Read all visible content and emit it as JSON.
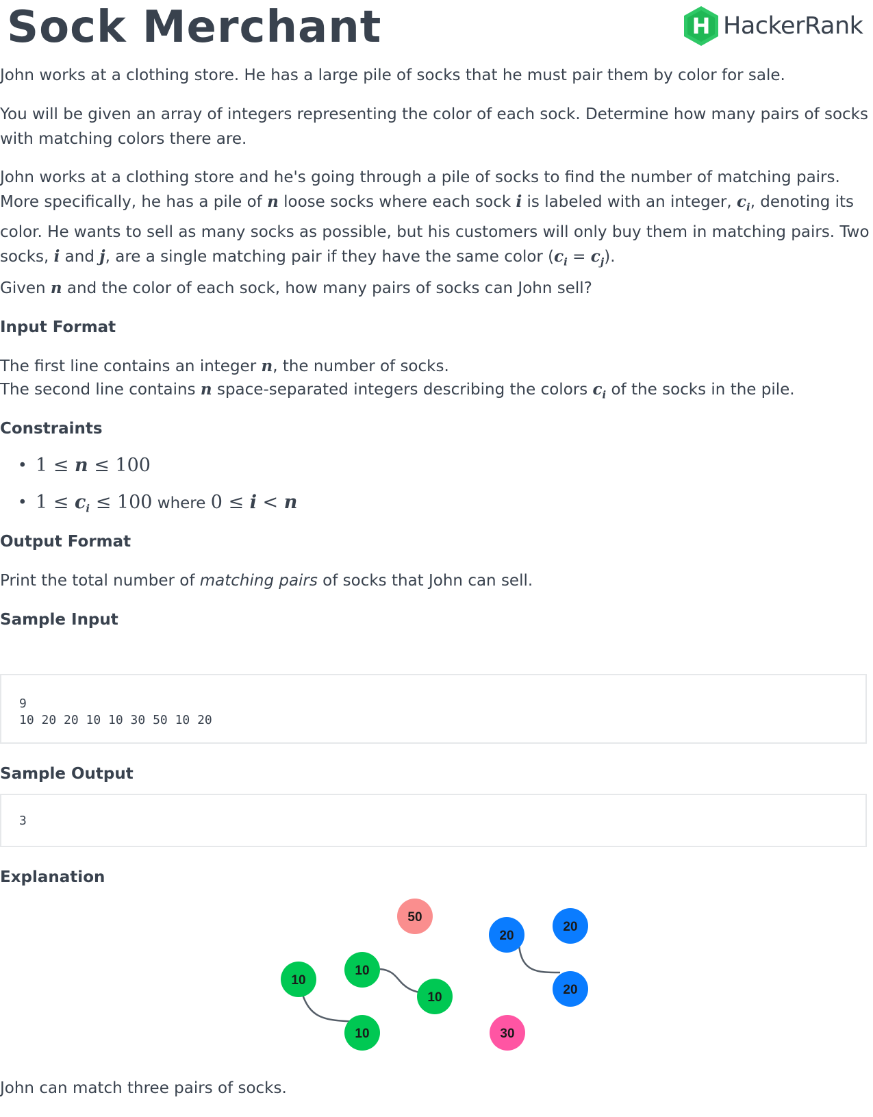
{
  "header": {
    "title": "Sock Merchant",
    "brand": "HackerRank",
    "brand_badge": "H",
    "brand_color": "#2ec866"
  },
  "intro": {
    "p1": "John works at a clothing store. He has a large pile of socks that he must pair them by color for sale.",
    "p2": "You will be given an array of integers representing the color of each sock. Determine how many pairs of socks with matching colors there are.",
    "p3_a": "John works at a clothing store and he's going through a pile of socks to find the number of matching pairs. More specifically, he has a pile of ",
    "p3_n": "n",
    "p3_b": " loose socks where each sock ",
    "p3_i": "i",
    "p3_c": " is labeled with an integer, ",
    "p3_ci": "c",
    "p3_ci_sub": "i",
    "p3_d": ", denoting its color. He wants to sell as many socks as possible, but his customers will only buy them in matching pairs. Two socks, ",
    "p3_i2": "i",
    "p3_e": " and ",
    "p3_j": "j",
    "p3_f": ", are a single matching pair if they have the same color (",
    "p3_eq_a": "c",
    "p3_eq_a_sub": "i",
    "p3_eq_op": " = ",
    "p3_eq_b": "c",
    "p3_eq_b_sub": "j",
    "p3_g": ").",
    "p4_a": "Given ",
    "p4_n": "n",
    "p4_b": " and the color of each sock, how many pairs of socks can John sell?"
  },
  "input_format": {
    "heading": "Input Format",
    "line1_a": "The first line contains an integer ",
    "line1_n": "n",
    "line1_b": ", the number of socks.",
    "line2_a": "The second line contains ",
    "line2_n": "n",
    "line2_b": " space-separated integers describing the colors ",
    "line2_c": "c",
    "line2_c_sub": "i",
    "line2_d": " of the socks in the pile."
  },
  "constraints": {
    "heading": "Constraints",
    "c1_a": "1 ≤ ",
    "c1_n": "n",
    "c1_b": " ≤ 100",
    "c2_a": "1 ≤ ",
    "c2_c": "c",
    "c2_c_sub": "i",
    "c2_b": " ≤ 100",
    "c2_where": " where ",
    "c2_d": "0 ≤ ",
    "c2_i": "i",
    "c2_e": " < ",
    "c2_n": "n"
  },
  "output_format": {
    "heading": "Output Format",
    "text_a": "Print the total number of ",
    "text_em": "matching pairs",
    "text_b": " of socks that John can sell."
  },
  "sample_input": {
    "heading": "Sample Input",
    "line1": "9",
    "line2": "10 20 20 10 10 30 50 10 20"
  },
  "sample_output": {
    "heading": "Sample Output",
    "value": "3"
  },
  "explanation": {
    "heading": "Explanation",
    "colors": {
      "green": "#00c853",
      "blue": "#0a7cff",
      "salmon": "#fa8e8e",
      "pink": "#ff55a3"
    },
    "socks": [
      "50",
      "20",
      "20",
      "10",
      "10",
      "10",
      "20",
      "10",
      "30"
    ],
    "closing": "John can match three pairs of socks."
  }
}
